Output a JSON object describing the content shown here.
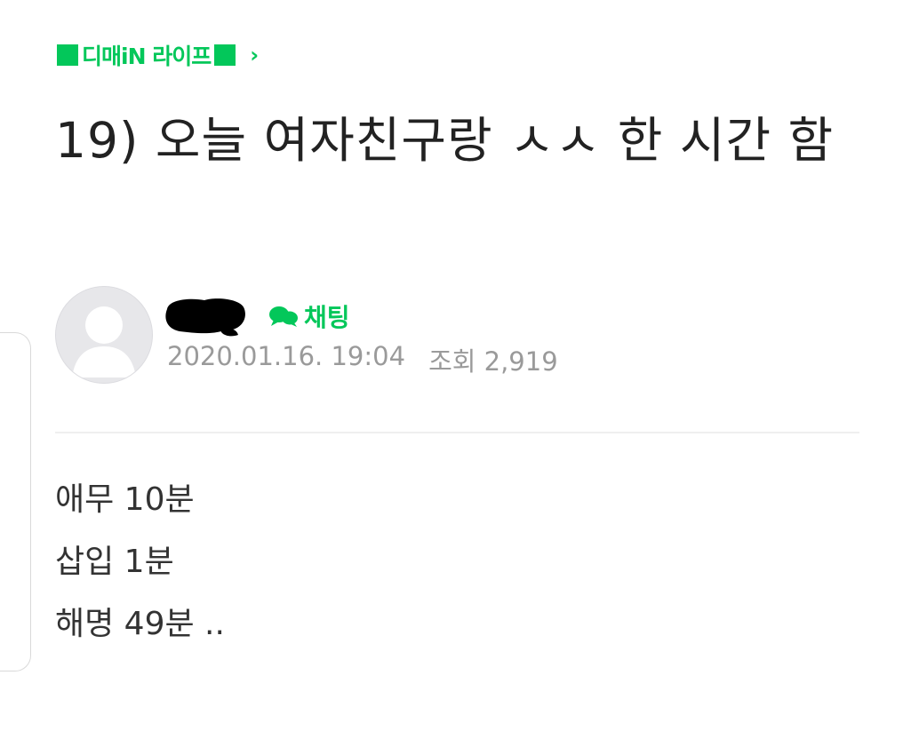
{
  "board": {
    "name": "디매iN 라이프",
    "chevron": "›",
    "accent_color": "#03c75a",
    "bullet_icon": "green-square-icon",
    "nav_icon": "chevron-right-icon"
  },
  "post": {
    "title": "19) 오늘 여자친구랑 ㅅㅅ 한 시간 함",
    "author_avatar_icon": "default-profile-icon",
    "author_name_state": "redacted",
    "chat_label": "채팅",
    "chat_icon": "chat-bubbles-icon",
    "date": "2020.01.16. 19:04",
    "views": "조회 2,919",
    "body": [
      "애무 10분",
      "삽입 1분",
      "해명 49분 .."
    ]
  }
}
